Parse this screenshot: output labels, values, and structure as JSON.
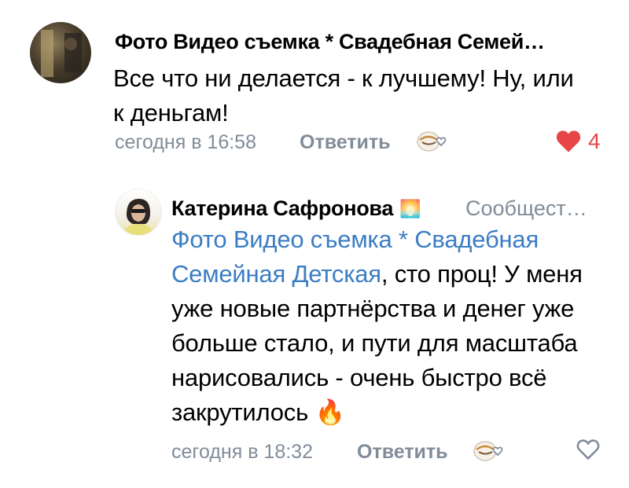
{
  "comments": [
    {
      "author": "Фото Видео съемка * Свадебная Семей…",
      "text": "Все что ни делается - к лучшему! Ну, или к деньгам!",
      "time": "сегодня в 16:58",
      "reply_label": "Ответить",
      "likes": "4",
      "liked": true
    },
    {
      "author": "Катерина Сафронова",
      "author_badge": "🌅",
      "community": "Сообщест…",
      "mention": "Фото Видео съемка * Свадебная Семейная Детская",
      "text": ", сто проц! У меня уже новые партнёрства и денег уже больше стало, и пути для масштаба нарисовались - очень быстро всё закрутилось 🔥",
      "time": "сегодня в 18:32",
      "reply_label": "Ответить",
      "liked": false
    }
  ],
  "colors": {
    "secondary": "#818c99",
    "mention": "#3b7dc4",
    "like_active": "#e64646"
  }
}
